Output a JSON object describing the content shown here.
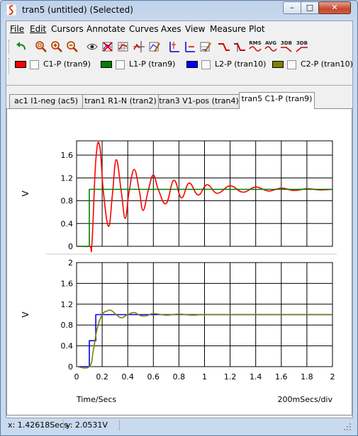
{
  "window": {
    "title": "tran5 (untitled) (Selected)",
    "controls": {
      "minimize": "–",
      "maximize": "□",
      "close": "✕"
    }
  },
  "menu": [
    {
      "label": "File",
      "key": "F"
    },
    {
      "label": "Edit",
      "key": "E"
    },
    {
      "label": "Cursors",
      "key": "C"
    },
    {
      "label": "Annotate",
      "key": "A"
    },
    {
      "label": "Curves",
      "key": "u"
    },
    {
      "label": "Axes",
      "key": "x"
    },
    {
      "label": "View",
      "key": "w"
    },
    {
      "label": "Measure",
      "key": "M"
    },
    {
      "label": "Plot",
      "key": "P"
    }
  ],
  "toolbar": {
    "icons": [
      "undo-icon",
      "zoom-fit-icon",
      "zoom-in-icon",
      "zoom-out-icon",
      "eye-icon",
      "delete-curve-icon",
      "add-curve-icon",
      "crosshair-icon",
      "edit-curve-icon",
      "add-axis-icon",
      "delete-axis-icon",
      "axis-edit-icon",
      "rise-icon",
      "fall-icon",
      "rms-icon",
      "avg-icon",
      "3db-low-icon",
      "3db-high-icon"
    ],
    "rms_label": "RMS",
    "avg_label": "AVG",
    "db3_label": "3DB",
    "db3b_label": "3DB"
  },
  "legend": [
    {
      "label": "C1-P (tran9)",
      "color": "#ff0000"
    },
    {
      "label": "L1-P (tran9)",
      "color": "#008000"
    },
    {
      "label": "L2-P (tran10)",
      "color": "#0000ff"
    },
    {
      "label": "C2-P (tran10)",
      "color": "#808000"
    }
  ],
  "tabs": [
    {
      "label": "ac1 I1-neg (ac5)",
      "active": false
    },
    {
      "label": "tran1 R1-N (tran2)",
      "active": false
    },
    {
      "label": "tran3 V1-pos (tran4)",
      "active": false
    },
    {
      "label": "tran5 C1-P (tran9)",
      "active": true
    }
  ],
  "plot": {
    "xlabel": "Time/Secs",
    "scale_label": "200mSecs/div",
    "x_ticks": [
      "0",
      "0.2",
      "0.4",
      "0.6",
      "0.8",
      "1",
      "1.2",
      "1.4",
      "1.6",
      "1.8",
      "2"
    ],
    "top": {
      "ylabel": "V",
      "y_ticks": [
        "0",
        "0.4",
        "0.8",
        "1.2",
        "1.6"
      ]
    },
    "bottom": {
      "ylabel": "V",
      "y_ticks": [
        "0",
        "0.4",
        "0.8",
        "1.2",
        "1.6",
        "2"
      ]
    }
  },
  "chart_data": [
    {
      "type": "line",
      "xlabel": "Time/Secs",
      "ylabel": "V",
      "xlim": [
        0,
        2
      ],
      "ylim": [
        0,
        1.85
      ],
      "grid": true,
      "series": [
        {
          "name": "C1-P (tran9)",
          "color": "#ff0000",
          "x": [
            0,
            0.1,
            0.12,
            0.15,
            0.18,
            0.21,
            0.25,
            0.28,
            0.31,
            0.35,
            0.38,
            0.41,
            0.45,
            0.49,
            0.52,
            0.56,
            0.6,
            0.64,
            0.7,
            0.76,
            0.82,
            0.88,
            0.95,
            1.02,
            1.1,
            1.2,
            1.3,
            1.4,
            1.5,
            1.6,
            1.7,
            1.8,
            1.9,
            2
          ],
          "y": [
            0,
            0,
            0.05,
            1.5,
            1.77,
            0.95,
            0.35,
            0.9,
            1.52,
            0.95,
            0.49,
            0.95,
            1.35,
            0.98,
            0.63,
            0.98,
            1.25,
            0.99,
            0.75,
            1.16,
            0.85,
            1.11,
            0.9,
            1.08,
            0.93,
            1.06,
            0.95,
            1.04,
            0.97,
            1.02,
            0.98,
            1.01,
            0.99,
            1.0
          ]
        },
        {
          "name": "L1-P (tran9)",
          "color": "#008000",
          "x": [
            0,
            0.1,
            0.1,
            2
          ],
          "y": [
            0,
            0,
            1.0,
            1.0
          ]
        }
      ]
    },
    {
      "type": "line",
      "xlabel": "Time/Secs",
      "ylabel": "V",
      "xlim": [
        0,
        2
      ],
      "ylim": [
        0,
        2
      ],
      "grid": true,
      "series": [
        {
          "name": "L2-P (tran10)",
          "color": "#0000ff",
          "x": [
            0,
            0.1,
            0.1,
            0.15,
            0.15,
            0.2,
            0.2,
            2
          ],
          "y": [
            0,
            0,
            0.5,
            0.5,
            1.0,
            1.0,
            1.0,
            1.0
          ]
        },
        {
          "name": "C2-P (tran10)",
          "color": "#808000",
          "x": [
            0,
            0.1,
            0.13,
            0.16,
            0.2,
            0.24,
            0.27,
            0.31,
            0.35,
            0.4,
            0.45,
            0.5,
            0.55,
            0.6,
            0.7,
            0.8,
            0.9,
            1.0,
            1.2,
            1.4,
            1.6,
            1.8,
            2
          ],
          "y": [
            0,
            0,
            0.3,
            0.72,
            1.0,
            1.07,
            1.08,
            1.0,
            0.94,
            1.0,
            1.04,
            0.98,
            0.98,
            1.02,
            0.99,
            1.01,
            0.99,
            1.0,
            1.0,
            1.0,
            1.0,
            1.0,
            1.0
          ]
        }
      ]
    }
  ],
  "status": {
    "x_readout": "x: 1.42618Secs",
    "y_readout": "y: 2.0531V"
  }
}
